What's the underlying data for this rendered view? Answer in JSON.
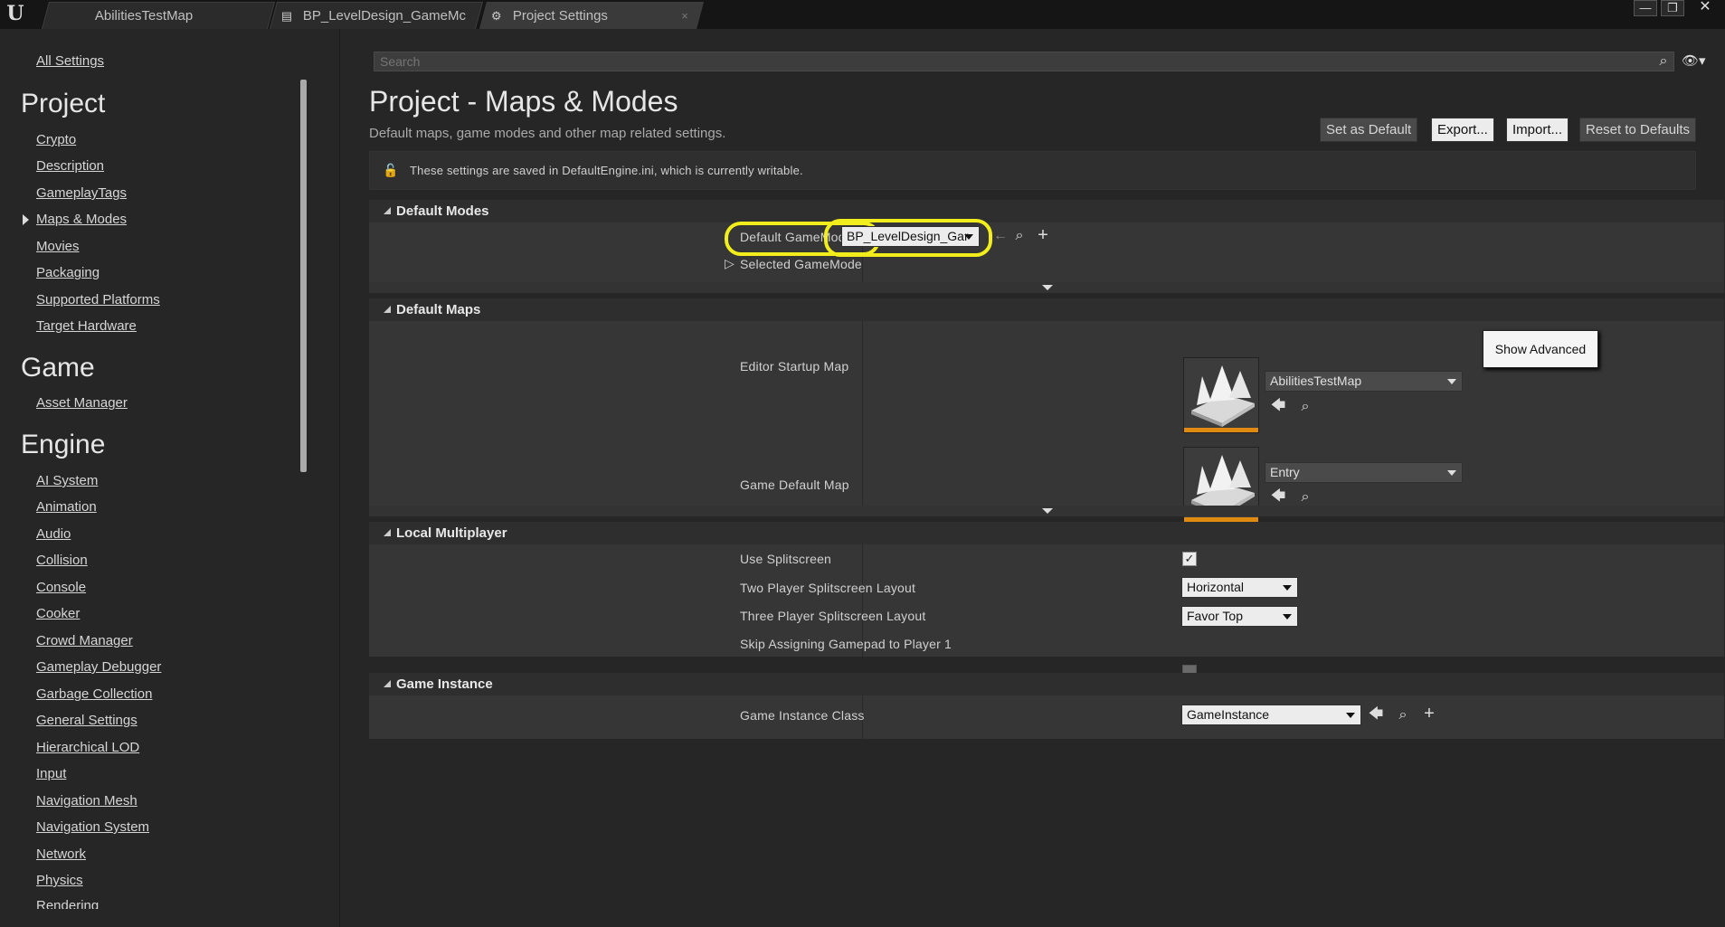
{
  "titlebar": {
    "tabs": [
      {
        "label": "AbilitiesTestMap"
      },
      {
        "label": "BP_LevelDesign_GameMc"
      },
      {
        "label": "Project Settings"
      }
    ],
    "window_controls": {
      "minimize": "—",
      "restore": "❐",
      "close": "✕"
    }
  },
  "nav": {
    "all_settings": "All Settings",
    "sections": [
      {
        "title": "Project",
        "items": [
          "Crypto",
          "Description",
          "GameplayTags",
          "Maps & Modes",
          "Movies",
          "Packaging",
          "Supported Platforms",
          "Target Hardware"
        ]
      },
      {
        "title": "Game",
        "items": [
          "Asset Manager"
        ]
      },
      {
        "title": "Engine",
        "items": [
          "AI System",
          "Animation",
          "Audio",
          "Collision",
          "Console",
          "Cooker",
          "Crowd Manager",
          "Gameplay Debugger",
          "Garbage Collection",
          "General Settings",
          "Hierarchical LOD",
          "Input",
          "Navigation Mesh",
          "Navigation System",
          "Network",
          "Physics",
          "Rendering"
        ]
      }
    ]
  },
  "search": {
    "placeholder": "Search"
  },
  "page": {
    "title": "Project - Maps & Modes",
    "subtitle": "Default maps, game modes and other map related settings.",
    "buttons": {
      "set_default": "Set as Default",
      "export": "Export...",
      "import": "Import...",
      "reset": "Reset to Defaults"
    },
    "notice": "These settings are saved in DefaultEngine.ini, which is currently writable."
  },
  "default_modes": {
    "header": "Default Modes",
    "gamemode_label": "Default GameMode",
    "gamemode_value": "BP_LevelDesign_Gar",
    "selected_label": "Selected GameMode"
  },
  "default_maps": {
    "header": "Default Maps",
    "editor_startup_label": "Editor Startup Map",
    "editor_startup_value": "AbilitiesTestMap",
    "game_default_label": "Game Default Map",
    "game_default_value": "Entry"
  },
  "tooltip": {
    "show_advanced": "Show Advanced"
  },
  "local_multiplayer": {
    "header": "Local Multiplayer",
    "use_splitscreen_label": "Use Splitscreen",
    "use_splitscreen": true,
    "two_player_label": "Two Player Splitscreen Layout",
    "two_player_value": "Horizontal",
    "three_player_label": "Three Player Splitscreen Layout",
    "three_player_value": "Favor Top",
    "skip_gamepad_label": "Skip Assigning Gamepad to Player 1",
    "skip_gamepad": false
  },
  "game_instance": {
    "header": "Game Instance",
    "class_label": "Game Instance Class",
    "class_value": "GameInstance"
  },
  "colors": {
    "highlight": "#f2ee1c",
    "thumb_accent": "#e08a10",
    "panel": "#363636"
  }
}
